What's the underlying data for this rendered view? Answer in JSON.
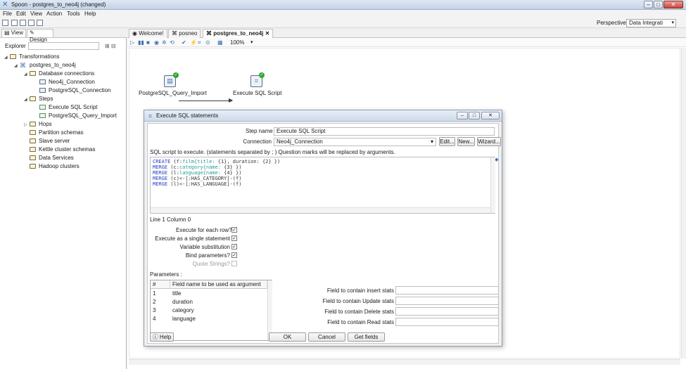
{
  "window": {
    "title": "Spoon - postgres_to_neo4j (changed)",
    "min": "–",
    "max": "□",
    "close": "✕"
  },
  "menu": [
    "File",
    "Edit",
    "View",
    "Action",
    "Tools",
    "Help"
  ],
  "perspective": {
    "label": "Perspective:",
    "value": "Data Integrati"
  },
  "left_panel": {
    "tabs": [
      "View",
      "Design"
    ],
    "explorer_label": "Explorer",
    "tree": [
      {
        "label": "Transformations",
        "level": 0,
        "icon": "folder",
        "toggle": "◢"
      },
      {
        "label": "postgres_to_neo4j",
        "level": 1,
        "icon": "transformation",
        "toggle": "◢"
      },
      {
        "label": "Database connections",
        "level": 2,
        "icon": "folder",
        "toggle": "◢"
      },
      {
        "label": "Neo4j_Connection",
        "level": 3,
        "icon": "connection",
        "toggle": ""
      },
      {
        "label": "PostgreSQL_Connection",
        "level": 3,
        "icon": "connection",
        "toggle": ""
      },
      {
        "label": "Steps",
        "level": 2,
        "icon": "folder",
        "toggle": "◢"
      },
      {
        "label": "Execute SQL Script",
        "level": 3,
        "icon": "step",
        "toggle": ""
      },
      {
        "label": "PostgreSQL_Query_Import",
        "level": 3,
        "icon": "step",
        "toggle": ""
      },
      {
        "label": "Hops",
        "level": 2,
        "icon": "folder",
        "toggle": "▷"
      },
      {
        "label": "Partition schemas",
        "level": 2,
        "icon": "folder",
        "toggle": ""
      },
      {
        "label": "Slave server",
        "level": 2,
        "icon": "folder",
        "toggle": ""
      },
      {
        "label": "Kettle cluster schemas",
        "level": 2,
        "icon": "folder",
        "toggle": ""
      },
      {
        "label": "Data Services",
        "level": 2,
        "icon": "folder",
        "toggle": ""
      },
      {
        "label": "Hadoop clusters",
        "level": 2,
        "icon": "folder",
        "toggle": ""
      }
    ]
  },
  "editor_tabs": [
    {
      "label": "Welcome!",
      "active": false
    },
    {
      "label": "posneo",
      "active": false
    },
    {
      "label": "postgres_to_neo4j",
      "active": true
    }
  ],
  "zoom": "100%",
  "canvas": {
    "steps": [
      {
        "label": "PostgreSQL_Query_Import"
      },
      {
        "label": "Execute SQL Script"
      }
    ]
  },
  "dialog": {
    "title": "Execute SQL statements",
    "step_name_label": "Step name",
    "step_name_value": "Execute SQL Script",
    "connection_label": "Connection",
    "connection_value": "Neo4j_Connection",
    "edit_button": "Edit...",
    "new_button": "New...",
    "wizard_button": "Wizard...",
    "sql_hint": "SQL script to execute. (statements separated by ; ) Question marks will be replaced by arguments.",
    "sql_lines": [
      "CREATE (f:film{title: {1}, duration: {2} })",
      "MERGE (c:category{name: {3} })",
      "MERGE (l:language{name: {4} })",
      "MERGE (c)<-[:HAS_CATEGORY]-(f)",
      "MERGE (l)<-[:HAS_LANGUAGE]-(f)"
    ],
    "cursor_position": "Line 1 Column 0",
    "options": [
      {
        "label": "Execute for each row?",
        "checked": true,
        "enabled": true
      },
      {
        "label": "Execute as a single statement",
        "checked": true,
        "enabled": true
      },
      {
        "label": "Variable substitution",
        "checked": true,
        "enabled": true
      },
      {
        "label": "Bind parameters?",
        "checked": true,
        "enabled": true
      },
      {
        "label": "Quote Strings?",
        "checked": false,
        "enabled": false
      }
    ],
    "parameters_label": "Parameters :",
    "param_columns": [
      "#",
      "Field name to be used as argument"
    ],
    "params": [
      {
        "n": "1",
        "field": "title"
      },
      {
        "n": "2",
        "field": "duration"
      },
      {
        "n": "3",
        "field": "category"
      },
      {
        "n": "4",
        "field": "language"
      }
    ],
    "stats_fields": [
      {
        "label": "Field to contain insert stats",
        "value": ""
      },
      {
        "label": "Field to contain Update stats",
        "value": ""
      },
      {
        "label": "Field to contain Delete stats",
        "value": ""
      },
      {
        "label": "Field to contain Read stats",
        "value": ""
      }
    ],
    "help_button": "Help",
    "ok_button": "OK",
    "cancel_button": "Cancel",
    "get_fields_button": "Get fields"
  }
}
